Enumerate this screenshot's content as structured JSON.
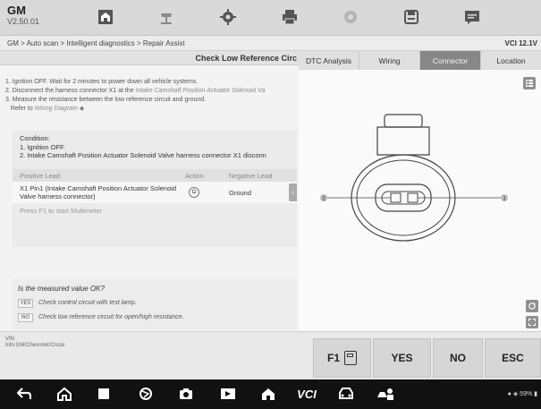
{
  "app": {
    "name": "GM",
    "version": "V2.50.01"
  },
  "toolbar_icons": [
    "home-icon",
    "vehicle-lift-icon",
    "settings-icon",
    "print-icon",
    "help-icon",
    "save-icon",
    "message-icon"
  ],
  "breadcrumb": "GM > Auto scan > Intelligent diagnostics > Repair Assist",
  "vci_status": "VCI 12.1V",
  "page_title": "Check Low Reference Circ",
  "steps": [
    {
      "text": "1. Ignition OFF. Wait for 2 minutes to power down all vehicle systems."
    },
    {
      "text": "2. Disconnect the harness connector X1 at the",
      "italic": "Intake Camshaft Position Actuator Solenoid Va"
    },
    {
      "text": "3. Measure the resistance between the low reference circuit and ground."
    },
    {
      "text": "Refer to",
      "italic": "Wiring Diagram"
    }
  ],
  "condition": {
    "label": "Condition:",
    "lines": [
      "1. Ignition OFF.",
      "2. Intake Camshaft Position Actuator Solenoid Valve harness connector X1 disconn"
    ]
  },
  "table": {
    "headers": {
      "positive": "Positive Lead",
      "action": "Action",
      "negative": "Negative Lead"
    },
    "row": {
      "positive": "X1 Pin1 (Intake Camshaft Position Actuator Solenoid Valve harness connector)",
      "action": "Ω",
      "negative": "Ground"
    }
  },
  "press_hint": "Press F1 to start Multimeter",
  "question": "Is the measured value OK?",
  "answers": [
    {
      "label": "YES",
      "text": "Check control circuit with test lamp."
    },
    {
      "label": "NO",
      "text": "Check low reference circuit for open/high resistance."
    }
  ],
  "tabs": [
    {
      "label": "DTC Analysis",
      "active": false
    },
    {
      "label": "Wiring",
      "active": false
    },
    {
      "label": "Connector",
      "active": true
    },
    {
      "label": "Location",
      "active": false
    }
  ],
  "connector": {
    "pin_left": "2",
    "pin_right": "1"
  },
  "vehicle": {
    "vin_label": "VIN",
    "info": "Info:GM/Chevrolet/Cruze"
  },
  "footer_buttons": {
    "f1": "F1",
    "yes": "YES",
    "no": "NO",
    "esc": "ESC"
  },
  "status": "59%",
  "colors": {
    "active_tab": "#878787",
    "panel": "#f3f3f3",
    "topbar": "#d9d9d9"
  }
}
